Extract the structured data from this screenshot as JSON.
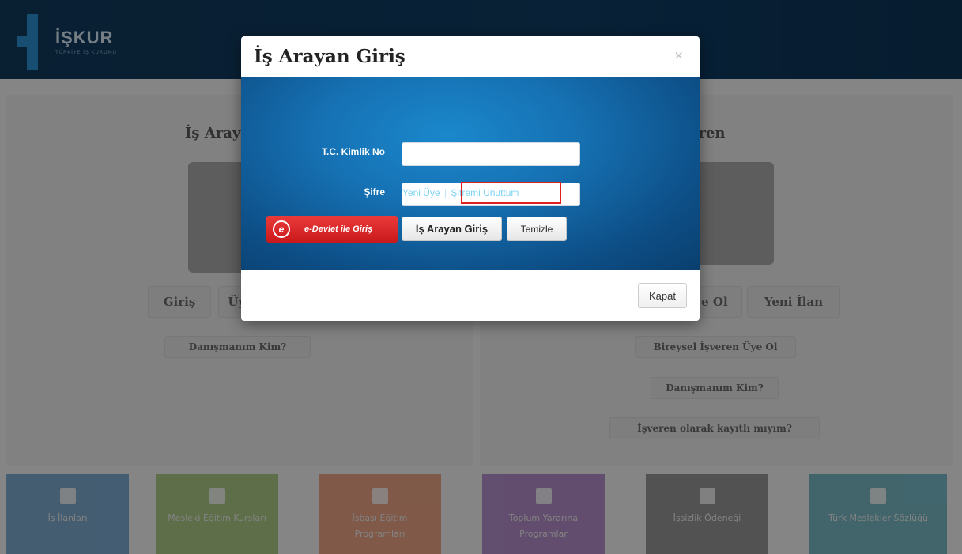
{
  "header": {
    "logo_text": "İŞKUR",
    "logo_subtitle": "TÜRKİYE İŞ KURUMU"
  },
  "left_panel": {
    "title": "İş Arayan",
    "buttons": [
      "Giriş",
      "Üye Ol"
    ],
    "advisor_button": "Danışmanım Kim?"
  },
  "right_panel": {
    "title": "İşveren",
    "buttons": [
      "Üye Ol",
      "Yeni İlan"
    ],
    "individual_employer": "Bireysel İşveren Üye Ol",
    "advisor_button": "Danışmanım Kim?",
    "registered_check": "İşveren olarak kayıtlı mıyım?"
  },
  "tiles": [
    {
      "label": "İş İlanları",
      "color": "#1f6db0",
      "icon": "newspaper-icon"
    },
    {
      "label": "Mesleki Eğitim Kursları",
      "color": "#6fa52b",
      "icon": "bookmark-icon"
    },
    {
      "label": "İşbaşı Eğitim Programları",
      "color": "#e2622a",
      "icon": "tag-icon"
    },
    {
      "label": "Toplum Yararına Programlar",
      "color": "#7d3aa8",
      "icon": "people-icon"
    },
    {
      "label": "İşsizlik Ödeneği",
      "color": "#4a4a4a",
      "icon": "money-icon"
    },
    {
      "label": "Türk Meslekler Sözlüğü",
      "color": "#148aa0",
      "icon": "book-icon"
    }
  ],
  "modal": {
    "title": "İş Arayan Giriş",
    "close_symbol": "×",
    "tc_label": "T.C. Kimlik No",
    "tc_value": "",
    "password_label": "Şifre",
    "password_value": "",
    "new_member_link": "Yeni Üye",
    "separator": "|",
    "forgot_password_link": "Şifremi Unuttum",
    "edevlet_button": "e-Devlet ile Giriş",
    "edevlet_logo": "e",
    "login_button": "İş Arayan Giriş",
    "clear_button": "Temizle",
    "close_button": "Kapat",
    "highlight_color": "#e0201f"
  }
}
